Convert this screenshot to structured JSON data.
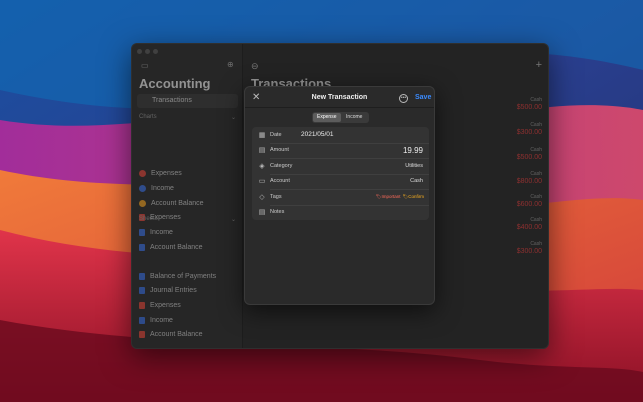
{
  "colors": {
    "accent": "#3a8bff",
    "expense_red": "#e23a3a",
    "window_bg": "#232323"
  },
  "sidebar": {
    "app_title": "Accounting",
    "selected_item": "Transactions",
    "sections": [
      {
        "title": "Charts",
        "items": [
          {
            "label": "Expenses",
            "color": "#e0453a",
            "icon": "pie-icon"
          },
          {
            "label": "Income",
            "color": "#3a6ee0",
            "icon": "pie-icon"
          },
          {
            "label": "Account Balance",
            "color": "#f0a020",
            "icon": "pie-icon"
          },
          {
            "label": "Expenses",
            "color": "#e0453a",
            "icon": "bar-icon"
          },
          {
            "label": "Income",
            "color": "#3a6ee0",
            "icon": "bar-icon"
          },
          {
            "label": "Account Balance",
            "color": "#3a6ee0",
            "icon": "bar-icon"
          }
        ]
      },
      {
        "title": "Sheets",
        "items": [
          {
            "label": "Balance of Payments",
            "color": "#3a6ee0",
            "icon": "sheet-icon"
          },
          {
            "label": "Journal Entries",
            "color": "#3a6ee0",
            "icon": "sheet-icon"
          },
          {
            "label": "Expenses",
            "color": "#e0453a",
            "icon": "sheet-icon"
          },
          {
            "label": "Income",
            "color": "#3a6ee0",
            "icon": "sheet-icon"
          },
          {
            "label": "Account Balance",
            "color": "#e0453a",
            "icon": "sheet-icon"
          }
        ]
      }
    ]
  },
  "main": {
    "title": "Transactions",
    "amounts": [
      {
        "label": "Cash",
        "value": "$500.00"
      },
      {
        "label": "Cash",
        "value": "$300.00"
      },
      {
        "label": "Cash",
        "value": "$500.00"
      },
      {
        "label": "Cash",
        "value": "$800.00"
      },
      {
        "label": "Cash",
        "value": "$600.00"
      },
      {
        "label": "Cash",
        "value": "$400.00"
      },
      {
        "label": "Cash",
        "value": "$300.00"
      }
    ]
  },
  "dialog": {
    "title": "New Transaction",
    "save_label": "Save",
    "segments": [
      "Expense",
      "Income"
    ],
    "selected_segment": "Expense",
    "fields": {
      "date_label": "Date",
      "date_value": "2021/05/01",
      "amount_label": "Amount",
      "amount_value": "19.99",
      "category_label": "Category",
      "category_value": "Utilities",
      "account_label": "Account",
      "account_value": "Cash",
      "tags_label": "Tags",
      "tag_1": "Important",
      "tag_2": "Confirm",
      "notes_label": "Notes"
    }
  }
}
